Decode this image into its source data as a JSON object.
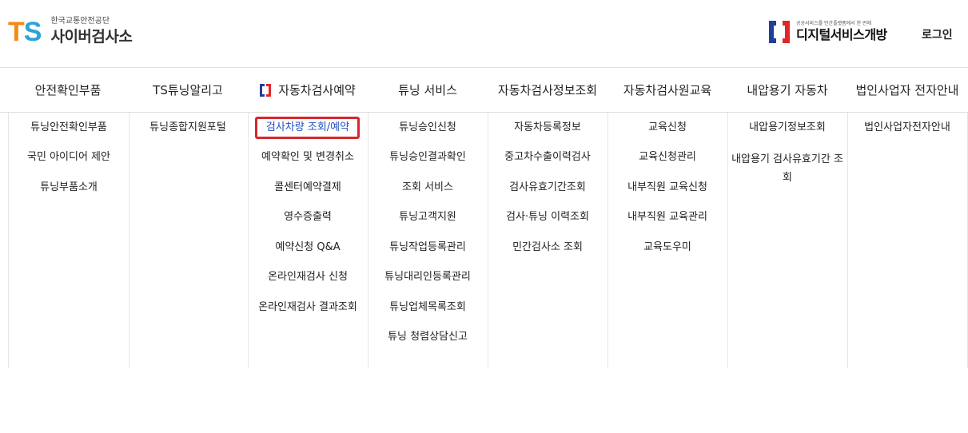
{
  "header": {
    "logo_mark_t": "T",
    "logo_mark_s": "S",
    "logo_subtitle": "한국교통안전공단",
    "logo_title": "사이버검사소",
    "digital_subtitle": "공공서비스를 민간플랫폼에서 한 번에",
    "digital_title": "디지털서비스개방",
    "login_label": "로그인"
  },
  "colors": {
    "ts_orange": "#f28a17",
    "ts_blue": "#2aa4d8",
    "brand_navy": "#1f3f9a",
    "brand_red": "#e0262b",
    "highlight_blue": "#1f4fbf"
  },
  "nav": {
    "items": [
      "안전확인부품",
      "TS튜닝알리고",
      "자동차검사예약",
      "튜닝 서비스",
      "자동차검사정보조회",
      "자동차검사원교육",
      "내압용기 자동차",
      "법인사업자 전자안내"
    ]
  },
  "menus": {
    "col0": [
      "튜닝안전확인부품",
      "국민 아이디어 제안",
      "튜닝부품소개"
    ],
    "col1": [
      "튜닝종합지원포털"
    ],
    "col2": [
      "검사차량 조회/예약",
      "예약확인 및 변경취소",
      "콜센터예약결제",
      "영수증출력",
      "예약신청 Q&A",
      "온라인재검사 신청",
      "온라인재검사 결과조회"
    ],
    "col3": [
      "튜닝승인신청",
      "튜닝승인결과확인",
      "조회 서비스",
      "튜닝고객지원",
      "튜닝작업등록관리",
      "튜닝대리인등록관리",
      "튜닝업체목록조회",
      "튜닝 청렴상담신고"
    ],
    "col4": [
      "자동차등록정보",
      "중고차수출이력검사",
      "검사유효기간조회",
      "검사·튜닝 이력조회",
      "민간검사소 조회"
    ],
    "col5": [
      "교육신청",
      "교육신청관리",
      "내부직원 교육신청",
      "내부직원 교육관리",
      "교육도우미"
    ],
    "col6": [
      "내압용기정보조회",
      "내압용기 검사유효기간 조회"
    ],
    "col7": [
      "법인사업자전자안내"
    ]
  }
}
